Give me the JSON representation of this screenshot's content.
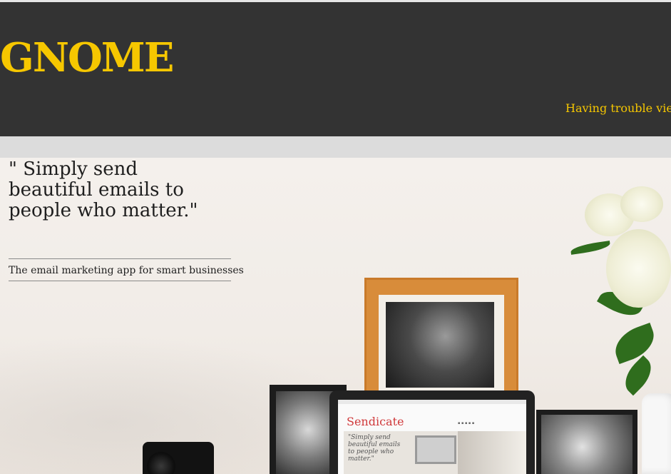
{
  "header": {
    "logo_text": "GNOME",
    "trouble_viewing_text": "Having trouble viewin"
  },
  "hero": {
    "quote": "\" Simply send beautiful emails to people who matter.\"",
    "tagline": "The email marketing app for smart businesses",
    "screen_brand": "Sendicate",
    "screen_quote": "\"Simply send beautiful emails to people who matter.\""
  },
  "colors": {
    "header_bg": "#333333",
    "accent": "#f6c700",
    "band": "#dcdcdc",
    "brand_red": "#d0393b"
  }
}
